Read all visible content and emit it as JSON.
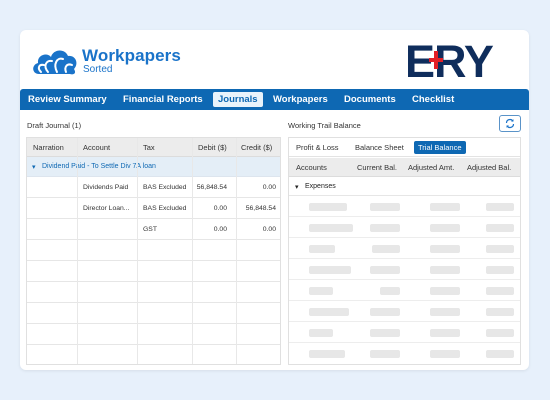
{
  "brand": {
    "app_name": "Workpapers",
    "app_tagline": "Sorted",
    "partner_logo_text": "ERY",
    "primary_color": "#0e68b3",
    "partner_color": "#0f2d5c",
    "partner_accent": "#e21f26"
  },
  "nav": {
    "items": [
      "Review Summary",
      "Financial Reports",
      "Journals",
      "Workpapers",
      "Documents",
      "Checklist"
    ],
    "active": "Journals"
  },
  "left": {
    "title": "Draft Journal (1)",
    "columns": [
      "Narration",
      "Account",
      "Tax",
      "Debit ($)",
      "Credit ($)"
    ],
    "group_label": "Dividend Paid - To Settle Div 7A loan",
    "rows": [
      {
        "account": "Dividends Paid",
        "tax": "BAS Excluded",
        "debit": "56,848.54",
        "credit": "0.00"
      },
      {
        "account": "Director Loan...",
        "tax": "BAS Excluded",
        "debit": "0.00",
        "credit": "56,848.54"
      },
      {
        "account": "",
        "tax": "GST",
        "debit": "0.00",
        "credit": "0.00"
      }
    ]
  },
  "right": {
    "title": "Working Trail Balance",
    "refresh_icon": "refresh-icon",
    "tabs": [
      "Profit & Loss",
      "Balance Sheet",
      "Trial Balance"
    ],
    "active_tab": "Trial Balance",
    "columns": [
      "Accounts",
      "Current Bal.",
      "Adjusted Amt.",
      "Adjusted Bal."
    ],
    "group_label": "Expenses"
  }
}
